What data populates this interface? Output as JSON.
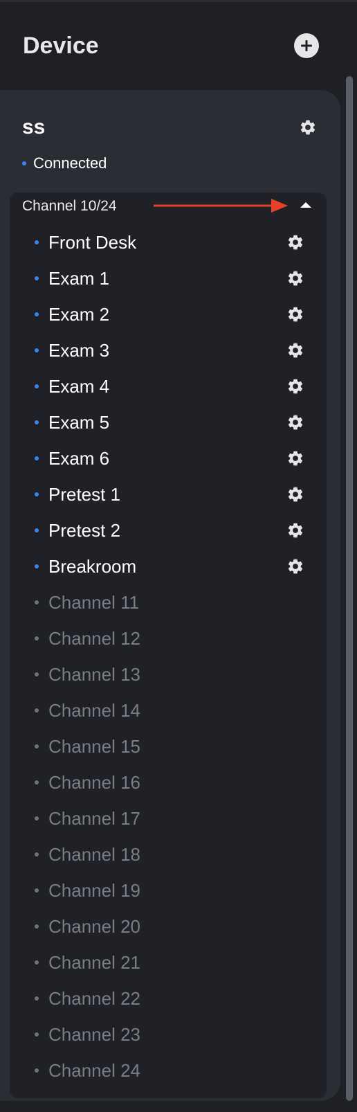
{
  "header": {
    "title": "Device",
    "add_icon": "plus-circle-icon"
  },
  "device": {
    "name": "ss",
    "status": "Connected",
    "status_color": "#3b82f6",
    "settings_icon": "gear-icon"
  },
  "channels": {
    "count_label": "Channel 10/24",
    "annotation_arrow_color": "#e8412a",
    "expanded": true,
    "active_color": "#3b82f6",
    "inactive_color": "#6d7078",
    "items": [
      {
        "label": "Front Desk",
        "active": true
      },
      {
        "label": "Exam 1",
        "active": true
      },
      {
        "label": "Exam 2",
        "active": true
      },
      {
        "label": "Exam 3",
        "active": true
      },
      {
        "label": "Exam 4",
        "active": true
      },
      {
        "label": "Exam 5",
        "active": true
      },
      {
        "label": "Exam 6",
        "active": true
      },
      {
        "label": "Pretest 1",
        "active": true
      },
      {
        "label": "Pretest 2",
        "active": true
      },
      {
        "label": "Breakroom",
        "active": true
      },
      {
        "label": "Channel 11",
        "active": false
      },
      {
        "label": "Channel 12",
        "active": false
      },
      {
        "label": "Channel 13",
        "active": false
      },
      {
        "label": "Channel 14",
        "active": false
      },
      {
        "label": "Channel 15",
        "active": false
      },
      {
        "label": "Channel 16",
        "active": false
      },
      {
        "label": "Channel 17",
        "active": false
      },
      {
        "label": "Channel 18",
        "active": false
      },
      {
        "label": "Channel 19",
        "active": false
      },
      {
        "label": "Channel 20",
        "active": false
      },
      {
        "label": "Channel 21",
        "active": false
      },
      {
        "label": "Channel 22",
        "active": false
      },
      {
        "label": "Channel 23",
        "active": false
      },
      {
        "label": "Channel 24",
        "active": false
      }
    ]
  }
}
